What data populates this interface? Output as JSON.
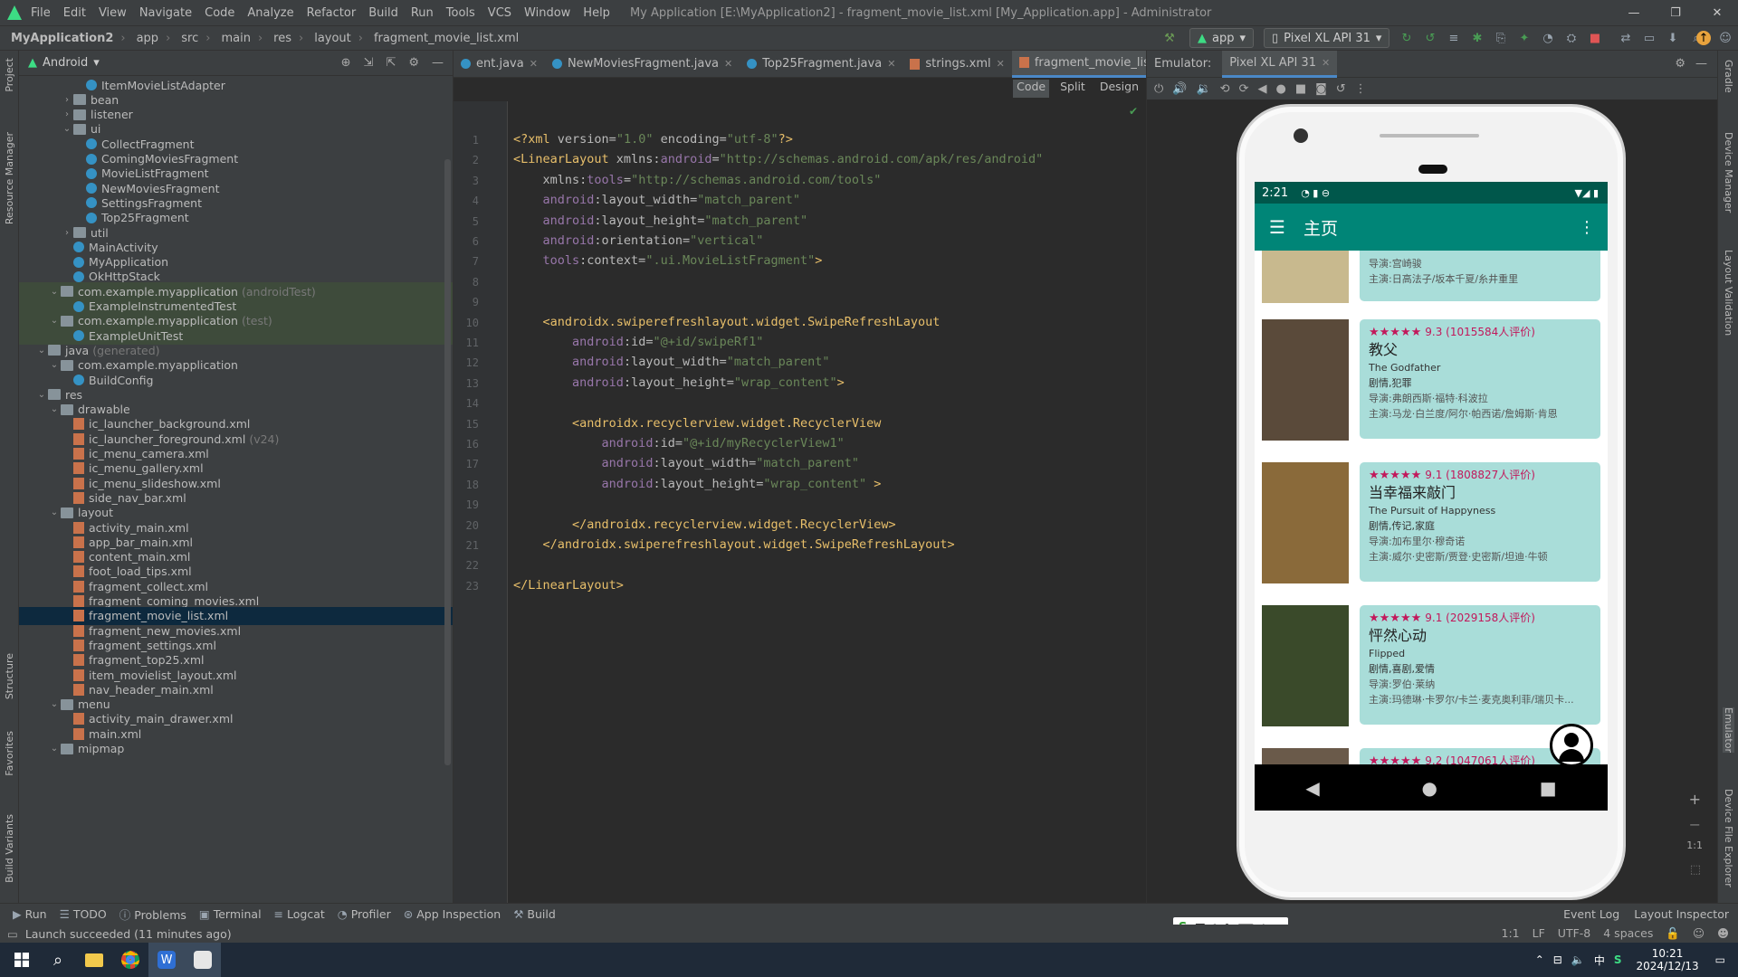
{
  "window": {
    "menu": [
      "File",
      "Edit",
      "View",
      "Navigate",
      "Code",
      "Analyze",
      "Refactor",
      "Build",
      "Run",
      "Tools",
      "VCS",
      "Window",
      "Help"
    ],
    "title": "My Application [E:\\MyApplication2] - fragment_movie_list.xml [My_Application.app] - Administrator"
  },
  "breadcrumb": [
    "MyApplication2",
    "app",
    "src",
    "main",
    "res",
    "layout",
    "fragment_movie_list.xml"
  ],
  "run_config": {
    "module": "app",
    "device": "Pixel XL API 31"
  },
  "left_strip": [
    "Project",
    "Resource Manager",
    "Structure",
    "Favorites",
    "Build Variants"
  ],
  "right_strip": [
    "Gradle",
    "Device Manager",
    "Layout Validation",
    "Emulator",
    "Device File Explorer"
  ],
  "project": {
    "view": "Android",
    "rows": [
      {
        "indent": 5,
        "icon": "cls",
        "label": "ItemMovieListAdapter"
      },
      {
        "indent": 4,
        "icon": "folder",
        "arrow": "▶",
        "label": "bean"
      },
      {
        "indent": 4,
        "icon": "folder",
        "arrow": "▶",
        "label": "listener"
      },
      {
        "indent": 4,
        "icon": "folder",
        "arrow": "▼",
        "label": "ui"
      },
      {
        "indent": 5,
        "icon": "cls",
        "label": "CollectFragment"
      },
      {
        "indent": 5,
        "icon": "cls",
        "label": "ComingMoviesFragment"
      },
      {
        "indent": 5,
        "icon": "cls",
        "label": "MovieListFragment"
      },
      {
        "indent": 5,
        "icon": "cls",
        "label": "NewMoviesFragment"
      },
      {
        "indent": 5,
        "icon": "cls",
        "label": "SettingsFragment"
      },
      {
        "indent": 5,
        "icon": "cls",
        "label": "Top25Fragment"
      },
      {
        "indent": 4,
        "icon": "folder",
        "arrow": "▶",
        "label": "util"
      },
      {
        "indent": 4,
        "icon": "cls",
        "label": "MainActivity"
      },
      {
        "indent": 4,
        "icon": "cls",
        "label": "MyApplication"
      },
      {
        "indent": 4,
        "icon": "cls",
        "label": "OkHttpStack"
      },
      {
        "indent": 3,
        "icon": "folder",
        "arrow": "▼",
        "label": "com.example.myapplication",
        "sub": "(androidTest)",
        "hl": true
      },
      {
        "indent": 4,
        "icon": "cls",
        "label": "ExampleInstrumentedTest",
        "hl": true
      },
      {
        "indent": 3,
        "icon": "folder",
        "arrow": "▼",
        "label": "com.example.myapplication",
        "sub": "(test)",
        "hl": true
      },
      {
        "indent": 4,
        "icon": "cls",
        "label": "ExampleUnitTest",
        "hl": true
      },
      {
        "indent": 2,
        "icon": "folder",
        "arrow": "▼",
        "label": "java",
        "sub": "(generated)"
      },
      {
        "indent": 3,
        "icon": "folder",
        "arrow": "▼",
        "label": "com.example.myapplication"
      },
      {
        "indent": 4,
        "icon": "cls",
        "label": "BuildConfig"
      },
      {
        "indent": 2,
        "icon": "folder",
        "arrow": "▼",
        "label": "res"
      },
      {
        "indent": 3,
        "icon": "folder",
        "arrow": "▼",
        "label": "drawable"
      },
      {
        "indent": 4,
        "icon": "xml",
        "label": "ic_launcher_background.xml"
      },
      {
        "indent": 4,
        "icon": "xml",
        "label": "ic_launcher_foreground.xml",
        "sub": "(v24)"
      },
      {
        "indent": 4,
        "icon": "xml",
        "label": "ic_menu_camera.xml"
      },
      {
        "indent": 4,
        "icon": "xml",
        "label": "ic_menu_gallery.xml"
      },
      {
        "indent": 4,
        "icon": "xml",
        "label": "ic_menu_slideshow.xml"
      },
      {
        "indent": 4,
        "icon": "xml",
        "label": "side_nav_bar.xml"
      },
      {
        "indent": 3,
        "icon": "folder",
        "arrow": "▼",
        "label": "layout"
      },
      {
        "indent": 4,
        "icon": "xml",
        "label": "activity_main.xml"
      },
      {
        "indent": 4,
        "icon": "xml",
        "label": "app_bar_main.xml"
      },
      {
        "indent": 4,
        "icon": "xml",
        "label": "content_main.xml"
      },
      {
        "indent": 4,
        "icon": "xml",
        "label": "foot_load_tips.xml"
      },
      {
        "indent": 4,
        "icon": "xml",
        "label": "fragment_collect.xml"
      },
      {
        "indent": 4,
        "icon": "xml",
        "label": "fragment_coming_movies.xml"
      },
      {
        "indent": 4,
        "icon": "xml",
        "label": "fragment_movie_list.xml",
        "selected": true
      },
      {
        "indent": 4,
        "icon": "xml",
        "label": "fragment_new_movies.xml"
      },
      {
        "indent": 4,
        "icon": "xml",
        "label": "fragment_settings.xml"
      },
      {
        "indent": 4,
        "icon": "xml",
        "label": "fragment_top25.xml"
      },
      {
        "indent": 4,
        "icon": "xml",
        "label": "item_movielist_layout.xml"
      },
      {
        "indent": 4,
        "icon": "xml",
        "label": "nav_header_main.xml"
      },
      {
        "indent": 3,
        "icon": "folder",
        "arrow": "▼",
        "label": "menu"
      },
      {
        "indent": 4,
        "icon": "xml",
        "label": "activity_main_drawer.xml"
      },
      {
        "indent": 4,
        "icon": "xml",
        "label": "main.xml"
      },
      {
        "indent": 3,
        "icon": "folder",
        "arrow": "▼",
        "label": "mipmap"
      }
    ]
  },
  "editor": {
    "tabs": [
      {
        "label": "ent.java",
        "kind": "java"
      },
      {
        "label": "NewMoviesFragment.java",
        "kind": "java"
      },
      {
        "label": "Top25Fragment.java",
        "kind": "java"
      },
      {
        "label": "strings.xml",
        "kind": "xml"
      },
      {
        "label": "fragment_movie_list.xml",
        "kind": "xml",
        "active": true
      }
    ],
    "modes": [
      "Code",
      "Split",
      "Design"
    ],
    "lines": [
      [
        [
          "t",
          "<?xml "
        ],
        [
          "at",
          "version="
        ],
        [
          "v",
          "\"1.0\" "
        ],
        [
          "at",
          "encoding="
        ],
        [
          "v",
          "\"utf-8\""
        ],
        [
          "t",
          "?>"
        ]
      ],
      [
        [
          "t",
          "<LinearLayout "
        ],
        [
          "at",
          "xmlns:"
        ],
        [
          "ns",
          "android"
        ],
        [
          "at",
          "="
        ],
        [
          "v",
          "\"http://schemas.android.com/apk/res/android\""
        ]
      ],
      [
        [
          "t",
          "    "
        ],
        [
          "at",
          "xmlns:"
        ],
        [
          "ns",
          "tools"
        ],
        [
          "at",
          "="
        ],
        [
          "v",
          "\"http://schemas.android.com/tools\""
        ]
      ],
      [
        [
          "t",
          "    "
        ],
        [
          "ns",
          "android"
        ],
        [
          "at",
          ":layout_width="
        ],
        [
          "v",
          "\"match_parent\""
        ]
      ],
      [
        [
          "t",
          "    "
        ],
        [
          "ns",
          "android"
        ],
        [
          "at",
          ":layout_height="
        ],
        [
          "v",
          "\"match_parent\""
        ]
      ],
      [
        [
          "t",
          "    "
        ],
        [
          "ns",
          "android"
        ],
        [
          "at",
          ":orientation="
        ],
        [
          "v",
          "\"vertical\""
        ]
      ],
      [
        [
          "t",
          "    "
        ],
        [
          "ns",
          "tools"
        ],
        [
          "at",
          ":context="
        ],
        [
          "v",
          "\".ui.MovieListFragment\""
        ],
        [
          "t",
          ">"
        ]
      ],
      [],
      [],
      [
        [
          "t",
          "    <androidx.swiperefreshlayout.widget.SwipeRefreshLayout"
        ]
      ],
      [
        [
          "t",
          "        "
        ],
        [
          "ns",
          "android"
        ],
        [
          "at",
          ":id="
        ],
        [
          "v",
          "\"@+id/swipeRf1\""
        ]
      ],
      [
        [
          "t",
          "        "
        ],
        [
          "ns",
          "android"
        ],
        [
          "at",
          ":layout_width="
        ],
        [
          "v",
          "\"match_parent\""
        ]
      ],
      [
        [
          "t",
          "        "
        ],
        [
          "ns",
          "android"
        ],
        [
          "at",
          ":layout_height="
        ],
        [
          "v",
          "\"wrap_content\""
        ],
        [
          "t",
          ">"
        ]
      ],
      [],
      [
        [
          "t",
          "        <androidx.recyclerview.widget.RecyclerView"
        ]
      ],
      [
        [
          "t",
          "            "
        ],
        [
          "ns",
          "android"
        ],
        [
          "at",
          ":id="
        ],
        [
          "v",
          "\"@+id/myRecyclerView1\""
        ]
      ],
      [
        [
          "t",
          "            "
        ],
        [
          "ns",
          "android"
        ],
        [
          "at",
          ":layout_width="
        ],
        [
          "v",
          "\"match_parent\""
        ]
      ],
      [
        [
          "t",
          "            "
        ],
        [
          "ns",
          "android"
        ],
        [
          "at",
          ":layout_height="
        ],
        [
          "v",
          "\"wrap_content\" "
        ],
        [
          "t",
          ">"
        ]
      ],
      [],
      [
        [
          "t",
          "        </androidx.recyclerview.widget.RecyclerView>"
        ]
      ],
      [
        [
          "t",
          "    </androidx.swiperefreshlayout.widget.SwipeRefreshLayout>"
        ]
      ],
      [],
      [
        [
          "t",
          "</LinearLayout>"
        ]
      ]
    ]
  },
  "emulator": {
    "label": "Emulator:",
    "tab": "Pixel XL API 31"
  },
  "phone": {
    "time": "2:21",
    "appbar_title": "主页",
    "top_partial": {
      "director": "导演:宫崎骏",
      "cast": "主演:日高法子/坂本千夏/糸井重里"
    },
    "movies": [
      {
        "stars": "★★★★★",
        "rating": "9.3 (1015584人评价)",
        "title_cn": "教父",
        "title_en": "The Godfather",
        "genre": "剧情,犯罪",
        "director": "导演:弗朗西斯·福特·科波拉",
        "cast": "主演:马龙·白兰度/阿尔·帕西诺/詹姆斯·肯恩"
      },
      {
        "stars": "★★★★★",
        "rating": "9.1 (1808827人评价)",
        "title_cn": "当幸福来敲门",
        "title_en": "The Pursuit of Happyness",
        "genre": "剧情,传记,家庭",
        "director": "导演:加布里尔·穆奇诺",
        "cast": "主演:威尔·史密斯/贾登·史密斯/坦迪·牛顿"
      },
      {
        "stars": "★★★★★",
        "rating": "9.1 (2029158人评价)",
        "title_cn": "怦然心动",
        "title_en": "Flipped",
        "genre": "剧情,喜剧,爱情",
        "director": "导演:罗伯·莱纳",
        "cast": "主演:玛德琳·卡罗尔/卡兰·麦克奥利菲/瑞贝卡..."
      },
      {
        "stars": "★★★★★",
        "rating": "9.2 (1047061人评价)"
      }
    ]
  },
  "toolwindows": [
    "Run",
    "TODO",
    "Problems",
    "Terminal",
    "Logcat",
    "Profiler",
    "App Inspection",
    "Build"
  ],
  "toolwindows_right": [
    "Event Log",
    "Layout Inspector"
  ],
  "status": {
    "message": "Launch succeeded (11 minutes ago)",
    "pos": "1:1",
    "sep": "LF",
    "enc": "UTF-8",
    "indent": "4 spaces"
  },
  "taskbar": {
    "time": "10:21",
    "date": "2024/12/13",
    "ime": "中"
  }
}
